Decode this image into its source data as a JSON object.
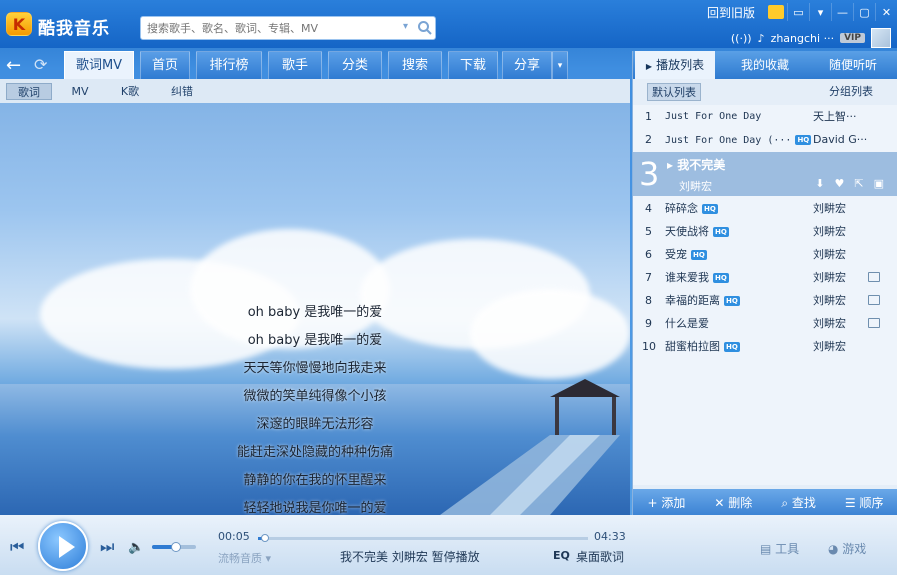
{
  "app": {
    "title": "酷我音乐",
    "logo_letter": "K"
  },
  "search": {
    "placeholder": "搜索歌手、歌名、歌词、专辑、MV"
  },
  "topbar": {
    "old_version": "回到旧版",
    "username": "zhangchi ···",
    "vip": "VIP"
  },
  "nav_tabs": [
    "歌词MV",
    "首页",
    "排行榜",
    "歌手",
    "分类",
    "搜索",
    "下载",
    "分享"
  ],
  "sub_tabs": [
    "歌词",
    "MV",
    "K歌",
    "纠错"
  ],
  "lyrics": [
    "oh baby 是我唯一的爱",
    "oh baby 是我唯一的爱",
    "天天等你慢慢地向我走来",
    "微微的笑单纯得像个小孩",
    "深邃的眼眸无法形容",
    "能赶走深处隐藏的种种伤痛",
    "静静的你在我的怀里醒来",
    "轻轻地说我是你唯一的爱"
  ],
  "panel": {
    "tabs": [
      "播放列表",
      "我的收藏",
      "随便听听"
    ],
    "default_list": "默认列表",
    "group_list": "分组列表",
    "now_playing": {
      "num": "3",
      "title": "我不完美",
      "artist": "刘畊宏"
    },
    "rows": [
      {
        "num": "1",
        "title": "Just For One Day",
        "artist": "天上智···",
        "hq": false,
        "mv": false
      },
      {
        "num": "2",
        "title": "Just For One Day (···",
        "artist": "David G···",
        "hq": true,
        "mv": false
      },
      {
        "num": "4",
        "title": "碎碎念",
        "artist": "刘畊宏",
        "hq": true,
        "mv": false
      },
      {
        "num": "5",
        "title": "天使战将",
        "artist": "刘畊宏",
        "hq": true,
        "mv": false
      },
      {
        "num": "6",
        "title": "受宠",
        "artist": "刘畊宏",
        "hq": true,
        "mv": false
      },
      {
        "num": "7",
        "title": "谁来爱我",
        "artist": "刘畊宏",
        "hq": true,
        "mv": true
      },
      {
        "num": "8",
        "title": "幸福的距离",
        "artist": "刘畊宏",
        "hq": true,
        "mv": true
      },
      {
        "num": "9",
        "title": "什么是爱",
        "artist": "刘畊宏",
        "hq": false,
        "mv": true
      },
      {
        "num": "10",
        "title": "甜蜜柏拉图",
        "artist": "刘畊宏",
        "hq": true,
        "mv": false
      }
    ],
    "hq_label": "HQ",
    "footer": {
      "add": "+ 添加",
      "delete": "✕ 删除",
      "find": "⌕ 查找",
      "order": "☰ 顺序"
    }
  },
  "player": {
    "elapsed": "00:05",
    "total": "04:33",
    "progress": 0.02,
    "volume": 0.55,
    "quality": "流畅音质 ▾",
    "now_text": "我不完美 刘畊宏 暂停播放",
    "eq": "EQ",
    "desktop_lyrics": "桌面歌词",
    "tools": "工具",
    "games": "游戏"
  },
  "colors": {
    "accent": "#2f7bd2",
    "title_bar": "#1565c6",
    "panel_bg": "#eef4fb",
    "now_playing_bg": "#9dbde0"
  }
}
